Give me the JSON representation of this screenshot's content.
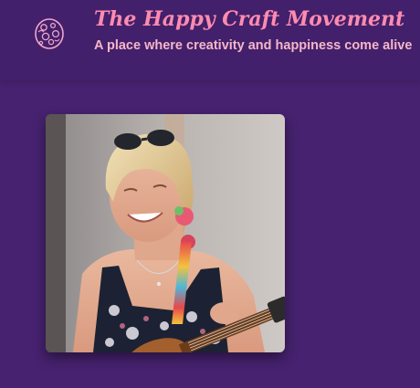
{
  "site": {
    "title": "The Happy Craft Movement",
    "tagline": "A place where creativity and happiness come alive",
    "logo_icon": "rounded-pattern-logo-icon"
  },
  "colors": {
    "background": "#472270",
    "header_background": "#43206b",
    "title": "#ff8bb0",
    "tagline": "#f6b6c9",
    "logo_stroke": "#f0a6c8"
  },
  "main": {
    "photo": {
      "icon": "portrait-photo"
    }
  }
}
